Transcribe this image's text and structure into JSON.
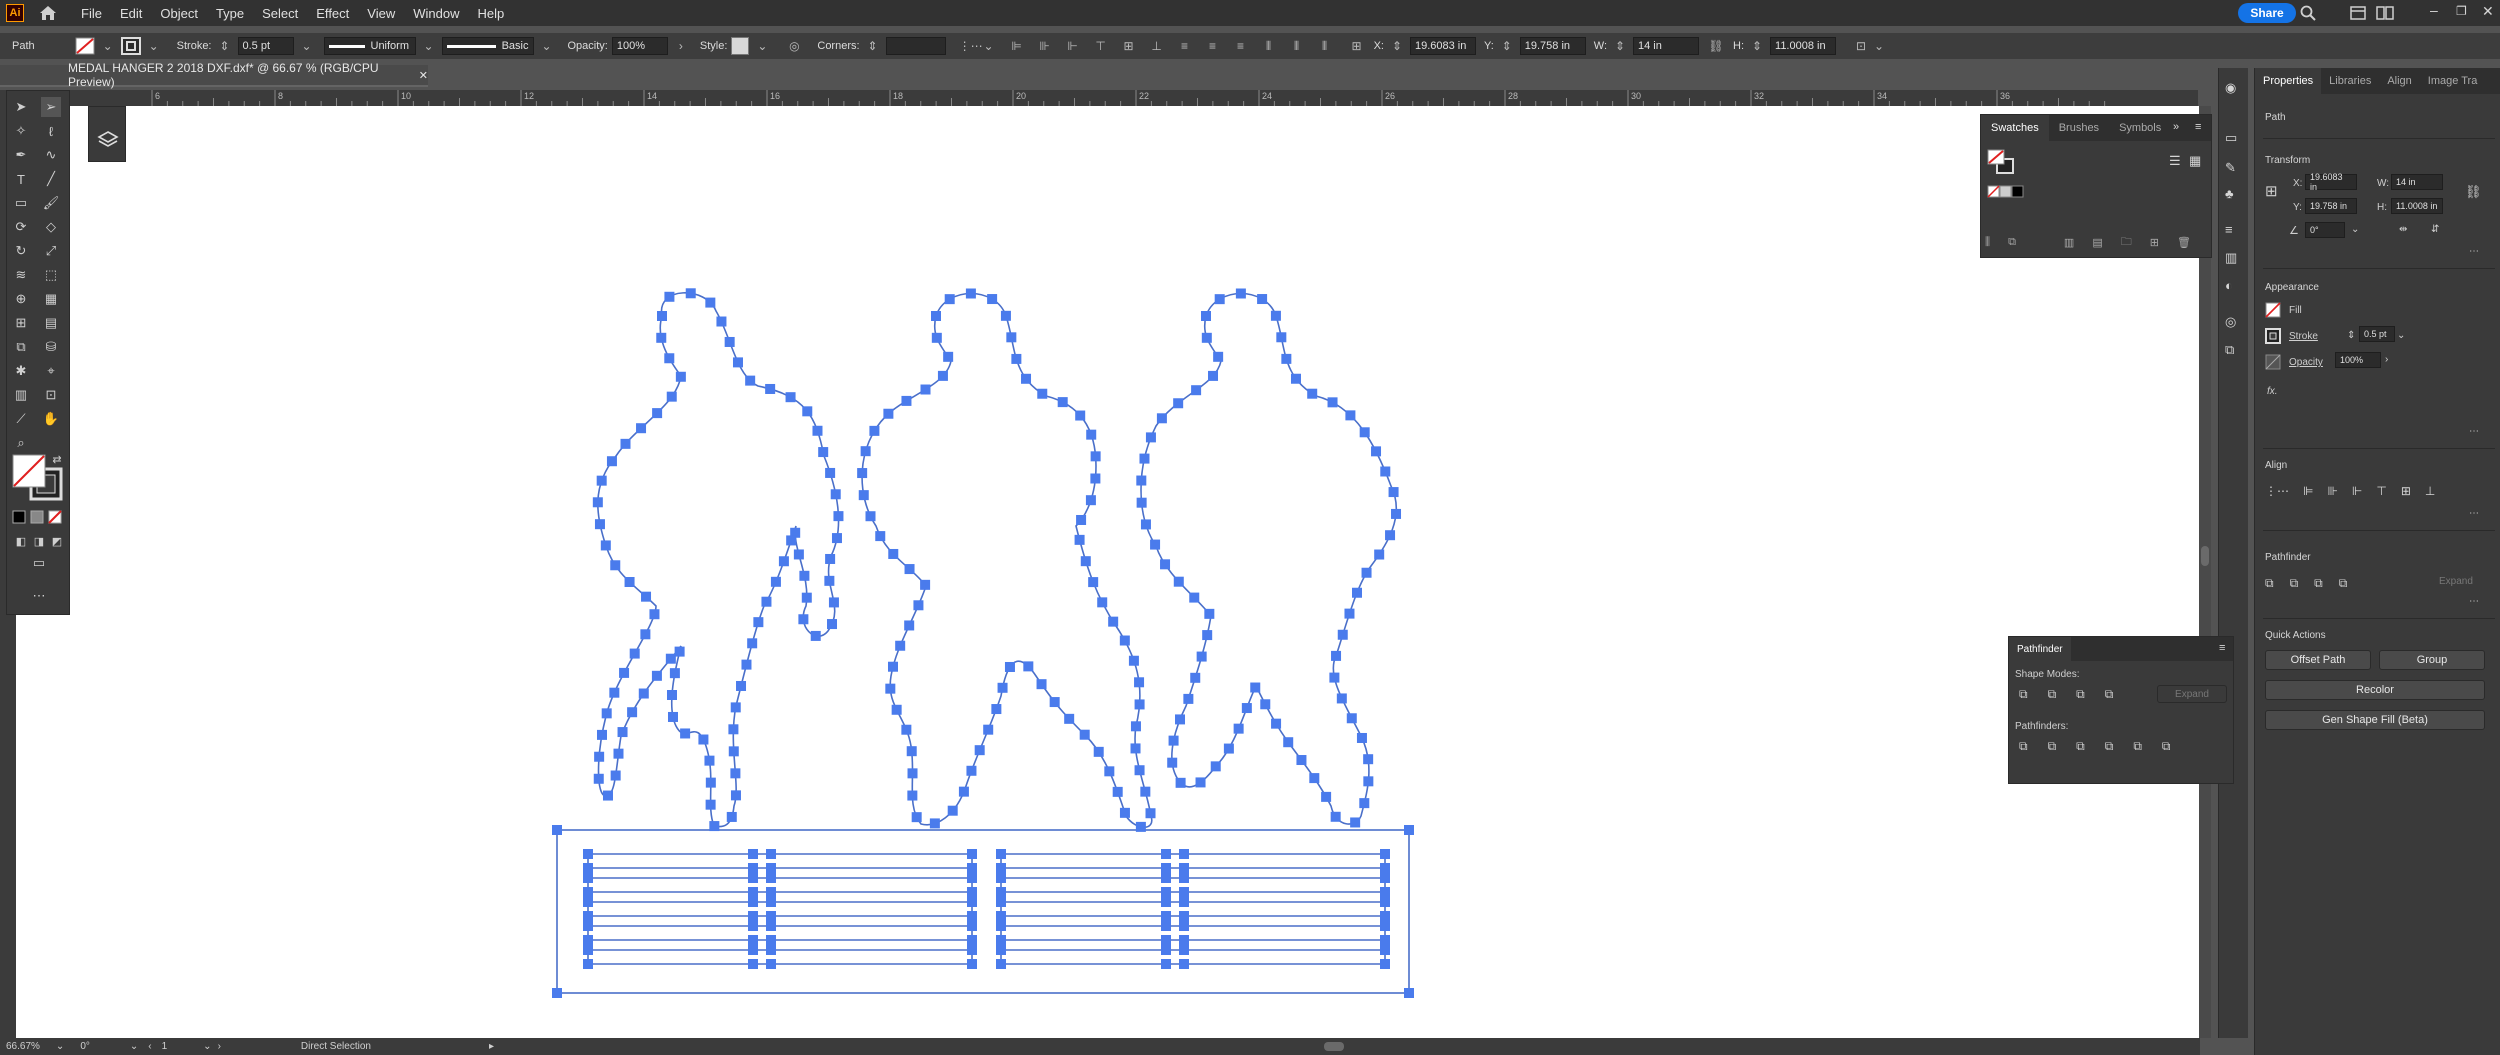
{
  "menubar": {
    "logo": "Ai",
    "items": [
      "File",
      "Edit",
      "Object",
      "Type",
      "Select",
      "Effect",
      "View",
      "Window",
      "Help"
    ],
    "share_label": "Share"
  },
  "controlbar": {
    "selection_type": "Path",
    "stroke_label": "Stroke:",
    "stroke_weight": "0.5 pt",
    "stroke_profile": "Uniform",
    "brush": "Basic",
    "opacity_label": "Opacity:",
    "opacity_value": "100%",
    "style_label": "Style:",
    "corners_label": "Corners:",
    "x_label": "X:",
    "x_value": "19.6083 in",
    "y_label": "Y:",
    "y_value": "19.758 in",
    "w_label": "W:",
    "w_value": "14 in",
    "h_label": "H:",
    "h_value": "11.0008 in"
  },
  "document_tab": {
    "title": "MEDAL HANGER 2 2018 DXF.dxf* @ 66.67 % (RGB/CPU Preview)"
  },
  "ruler": {
    "labels": [
      "6",
      "8",
      "10",
      "12",
      "14",
      "16",
      "18",
      "20",
      "22",
      "24",
      "26",
      "28",
      "30",
      "32",
      "34",
      "36"
    ]
  },
  "swatches_panel": {
    "tabs": [
      "Swatches",
      "Brushes",
      "Symbols"
    ]
  },
  "properties_panel": {
    "tabs": [
      "Properties",
      "Libraries",
      "Align",
      "Image Tra"
    ],
    "object_type": "Path",
    "transform_title": "Transform",
    "x_label": "X:",
    "x_value": "19.6083 in",
    "y_label": "Y:",
    "y_value": "19.758 in",
    "w_label": "W:",
    "w_value": "14 in",
    "h_label": "H:",
    "h_value": "11.0008 in",
    "angle_value": "0°",
    "appearance_title": "Appearance",
    "fill_label": "Fill",
    "stroke_label": "Stroke",
    "stroke_value": "0.5 pt",
    "opacity_label": "Opacity",
    "opacity_value": "100%",
    "fx_label": "fx.",
    "align_title": "Align",
    "pathfinder_title": "Pathfinder",
    "expand_label": "Expand",
    "quick_actions_title": "Quick Actions",
    "offset_path_label": "Offset Path",
    "group_label": "Group",
    "recolor_label": "Recolor",
    "gen_shape_fill_label": "Gen Shape Fill (Beta)"
  },
  "pathfinder_panel": {
    "title": "Pathfinder",
    "shape_modes_label": "Shape Modes:",
    "pathfinders_label": "Pathfinders:",
    "expand_label": "Expand"
  },
  "statusbar": {
    "zoom": "66.67%",
    "rotation": "0°",
    "artboard_number": "1",
    "tool_name": "Direct Selection"
  },
  "colors": {
    "path_blue": "#4a7bec",
    "share_blue": "#1473e6",
    "ui_dark": "#323232"
  }
}
